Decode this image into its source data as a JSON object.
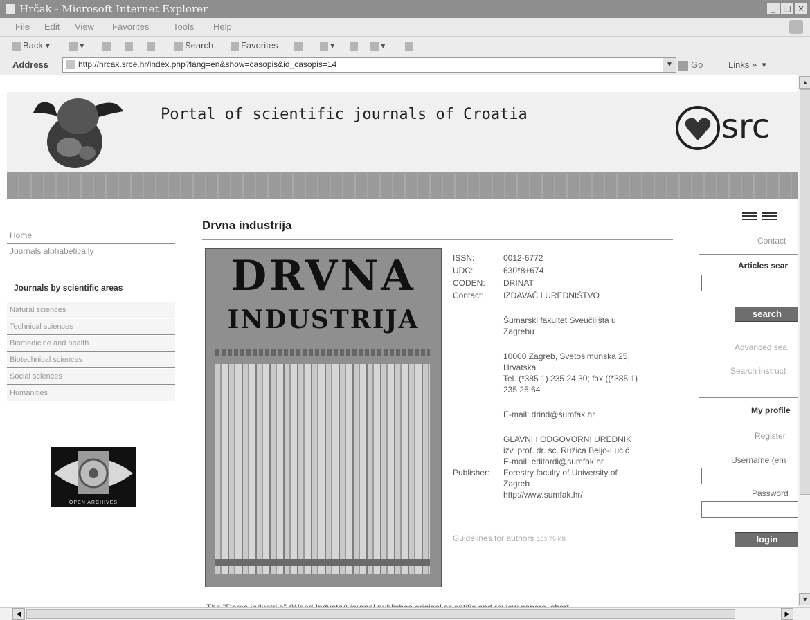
{
  "window": {
    "title": "Hrčak - Microsoft Internet Explorer",
    "controls": [
      "_",
      "□",
      "×"
    ]
  },
  "menu": [
    "File",
    "Edit",
    "View",
    "Favorites",
    "Tools",
    "Help"
  ],
  "toolbar": {
    "back": "Back",
    "search": "Search",
    "favorites": "Favorites"
  },
  "address": {
    "label": "Address",
    "url": "http://hrcak.srce.hr/index.php?lang=en&show=casopis&id_casopis=14",
    "go": "Go",
    "links": "Links"
  },
  "header": {
    "title": "Portal of scientific journals of Croatia",
    "brand": "src"
  },
  "nav": {
    "home": "Home",
    "alphabetical": "Journals alphabetically",
    "areas_title": "Journals by scientific areas",
    "areas": [
      "Natural sciences",
      "Technical sciences",
      "Biomedicine and health",
      "Biotechnical sciences",
      "Social sciences",
      "Humanities"
    ],
    "archive_label": "OPEN ARCHIVES"
  },
  "journal": {
    "title": "Drvna industrija",
    "cover_line1": "DRVNA",
    "cover_line2": "INDUSTRIJA",
    "issn_label": "ISSN:",
    "issn": "0012-6772",
    "udc_label": "UDC:",
    "udc": "630*8+674",
    "coden_label": "CODEN:",
    "coden": "DRINAT",
    "contact_label": "Contact:",
    "contact_lines": [
      "IZDAVAČ I UREDNIŠTVO",
      "Šumarski fakultet Sveučilišta u",
      "Zagrebu",
      "10000 Zagreb, Svetošimunska 25,",
      "Hrvatska",
      "Tel. (*385 1) 235 24 30; fax ((*385 1)",
      "235 25 64",
      "E-mail: drind@sumfak.hr",
      "GLAVNI I ODGOVORNI UREDNIK",
      "izv. prof. dr. sc. Ružica Beljo-Lučić",
      "E-mail: editordi@sumfak.hr"
    ],
    "publisher_label": "Publisher:",
    "publisher_lines": [
      "Forestry faculty of University of",
      "Zagreb",
      "http://www.sumfak.hr/"
    ],
    "guidelines": "Guidelines for authors",
    "guidelines_size": "103.79 KB",
    "description": "The \"Drvna industrija\" (Wood Industry) journal publishes original scientific and review papers, short"
  },
  "right": {
    "contact": "Contact",
    "articles_search": "Articles sear",
    "search_button": "search",
    "advanced": "Advanced sea",
    "instructions": "Search instruct",
    "my_profile": "My profile",
    "register": "Register",
    "username": "Username (em",
    "password": "Password",
    "login_button": "login"
  },
  "colors": {
    "title_bar": "#8e8e8e",
    "button": "#6e6e6e",
    "rule": "#9a9a9a"
  }
}
